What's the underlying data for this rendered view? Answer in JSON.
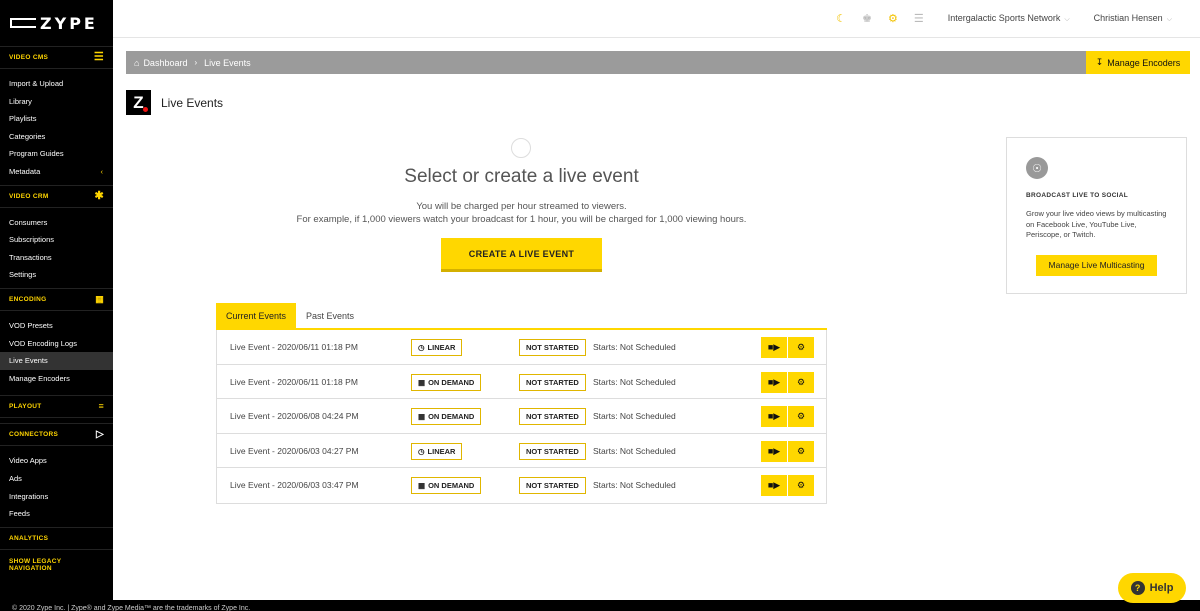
{
  "sidebar": {
    "logo": "ZYPE",
    "sections": [
      {
        "label": "VIDEO CMS",
        "icon": "hamburger-icon",
        "items": [
          "Import & Upload",
          "Library",
          "Playlists",
          "Categories",
          "Program Guides",
          "Metadata"
        ]
      },
      {
        "label": "VIDEO CRM",
        "icon": "asterisk-icon",
        "items": [
          "Consumers",
          "Subscriptions",
          "Transactions",
          "Settings"
        ]
      },
      {
        "label": "ENCODING",
        "icon": "grid-icon",
        "items": [
          "VOD Presets",
          "VOD Encoding Logs",
          "Live Events",
          "Manage Encoders"
        ]
      },
      {
        "label": "PLAYOUT",
        "icon": "playout-icon",
        "items": []
      },
      {
        "label": "CONNECTORS",
        "icon": "play-icon",
        "items": [
          "Video Apps",
          "Ads",
          "Integrations",
          "Feeds"
        ]
      },
      {
        "label": "ANALYTICS"
      },
      {
        "label": "SHOW LEGACY NAVIGATION"
      }
    ],
    "active_item": "Live Events"
  },
  "topbar": {
    "network": "Intergalactic Sports Network",
    "user": "Christian Hensen"
  },
  "breadcrumb": {
    "home": "Dashboard",
    "current": "Live Events",
    "manage_encoders": "Manage Encoders"
  },
  "page": {
    "title": "Live Events",
    "headline": "Select or create a live event",
    "desc_line1": "You will be charged per hour streamed to viewers.",
    "desc_line2": "For example, if 1,000 viewers watch your broadcast for 1 hour, you will be charged for 1,000 viewing hours.",
    "create_button": "CREATE A LIVE EVENT"
  },
  "tabs": [
    {
      "label": "Current Events",
      "active": true
    },
    {
      "label": "Past Events",
      "active": false
    }
  ],
  "events": [
    {
      "name": "Live Event - 2020/06/11 01:18 PM",
      "type": "LINEAR",
      "type_icon": "clock-icon",
      "status": "NOT STARTED",
      "starts": "Starts: Not Scheduled"
    },
    {
      "name": "Live Event - 2020/06/11 01:18 PM",
      "type": "ON DEMAND",
      "type_icon": "calendar-icon",
      "status": "NOT STARTED",
      "starts": "Starts: Not Scheduled"
    },
    {
      "name": "Live Event - 2020/06/08 04:24 PM",
      "type": "ON DEMAND",
      "type_icon": "calendar-icon",
      "status": "NOT STARTED",
      "starts": "Starts: Not Scheduled"
    },
    {
      "name": "Live Event - 2020/06/03 04:27 PM",
      "type": "LINEAR",
      "type_icon": "clock-icon",
      "status": "NOT STARTED",
      "starts": "Starts: Not Scheduled"
    },
    {
      "name": "Live Event - 2020/06/03 03:47 PM",
      "type": "ON DEMAND",
      "type_icon": "calendar-icon",
      "status": "NOT STARTED",
      "starts": "Starts: Not Scheduled"
    }
  ],
  "social_card": {
    "title": "BROADCAST LIVE TO SOCIAL",
    "text": "Grow your live video views by multicasting on Facebook Live, YouTube Live, Periscope, or Twitch.",
    "button": "Manage Live Multicasting"
  },
  "footer": "© 2020 Zype Inc. | Zype® and Zype Media™ are the trademarks of Zype Inc.",
  "help": "Help",
  "colors": {
    "accent": "#ffd700",
    "sidebar_bg": "#000000",
    "crumb_bg": "#9b9b9b"
  }
}
